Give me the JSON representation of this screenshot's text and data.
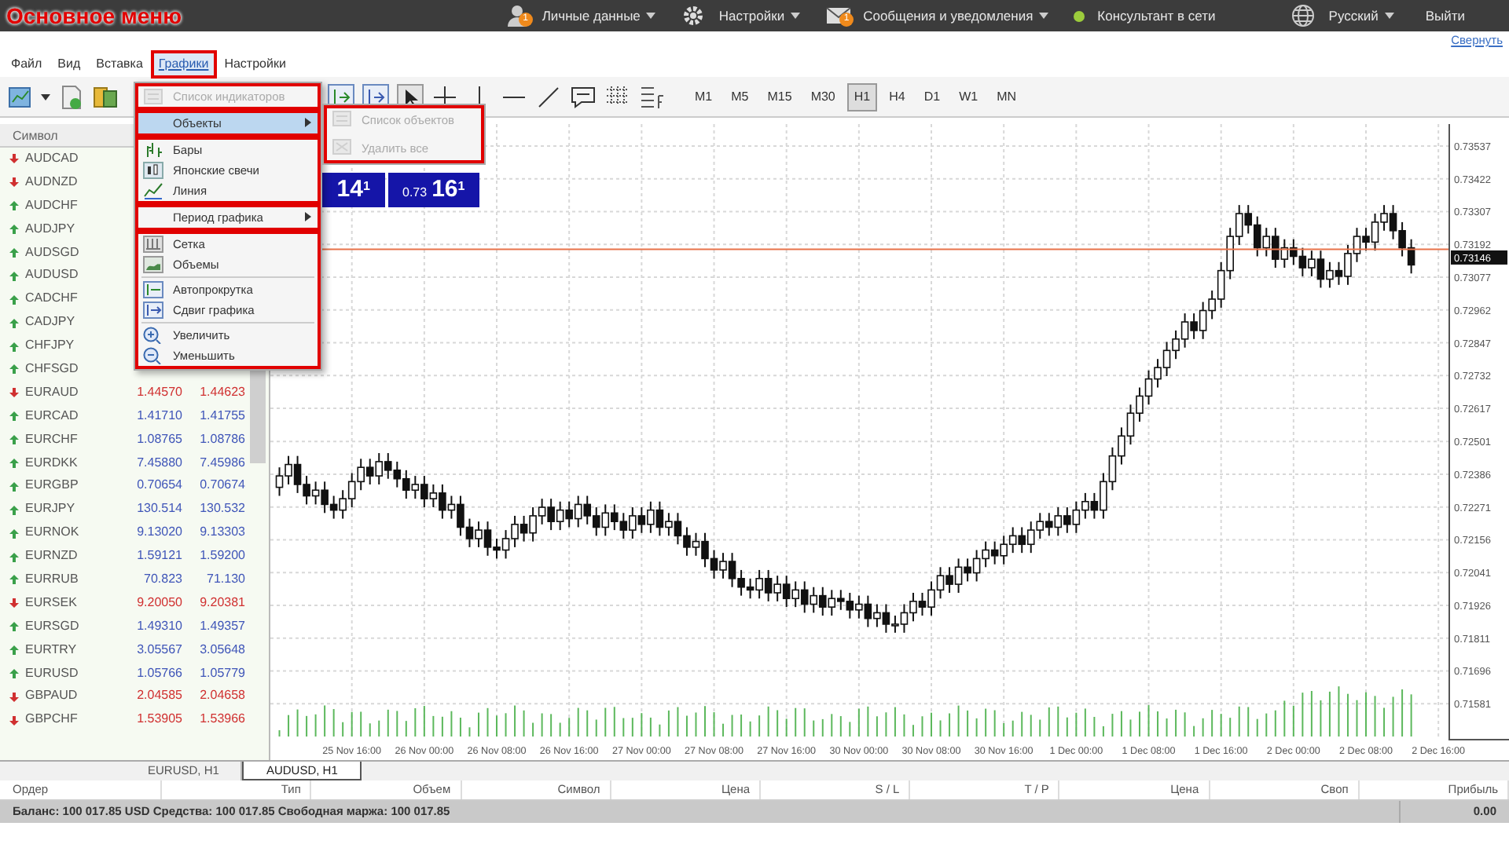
{
  "annotation": {
    "title": "Основное меню"
  },
  "top_bar": {
    "items": [
      {
        "kind": "user",
        "label": "Личные данные",
        "badge": "1",
        "dropdown": true
      },
      {
        "kind": "gear",
        "label": "Настройки",
        "dropdown": true
      },
      {
        "kind": "mail",
        "label": "Сообщения и уведомления",
        "badge": "1",
        "dropdown": true
      },
      {
        "kind": "status",
        "label": "Консультант в сети",
        "color": "#9ccc3c",
        "dropdown": false
      },
      {
        "kind": "globe",
        "label": "Русский",
        "dropdown": true
      },
      {
        "kind": "plain",
        "label": "Выйти",
        "dropdown": false
      }
    ]
  },
  "collapse_link": "Свернуть",
  "menu_bar": [
    {
      "label": "Файл",
      "selected": false
    },
    {
      "label": "Вид",
      "selected": false
    },
    {
      "label": "Вставка",
      "selected": false
    },
    {
      "label": "Графики",
      "selected": true
    },
    {
      "label": "Настройки",
      "selected": false
    }
  ],
  "timeframes": [
    {
      "label": "M1",
      "selected": false
    },
    {
      "label": "M5",
      "selected": false
    },
    {
      "label": "M15",
      "selected": false
    },
    {
      "label": "M30",
      "selected": false
    },
    {
      "label": "H1",
      "selected": true
    },
    {
      "label": "H4",
      "selected": false
    },
    {
      "label": "D1",
      "selected": false
    },
    {
      "label": "W1",
      "selected": false
    },
    {
      "label": "MN",
      "selected": false
    }
  ],
  "watchlist": {
    "columns": [
      "Символ"
    ],
    "rows": [
      {
        "symbol": "AUDCAD",
        "up": false
      },
      {
        "symbol": "AUDNZD",
        "up": false
      },
      {
        "symbol": "AUDCHF",
        "up": true
      },
      {
        "symbol": "AUDJPY",
        "up": true
      },
      {
        "symbol": "AUDSGD",
        "up": true
      },
      {
        "symbol": "AUDUSD",
        "up": true
      },
      {
        "symbol": "CADCHF",
        "up": true
      },
      {
        "symbol": "CADJPY",
        "up": true
      },
      {
        "symbol": "CHFJPY",
        "up": true
      },
      {
        "symbol": "CHFSGD",
        "up": true
      },
      {
        "symbol": "EURAUD",
        "up": false,
        "bid": "1.44570",
        "ask": "1.44623"
      },
      {
        "symbol": "EURCAD",
        "up": true,
        "bid": "1.41710",
        "ask": "1.41755"
      },
      {
        "symbol": "EURCHF",
        "up": true,
        "bid": "1.08765",
        "ask": "1.08786"
      },
      {
        "symbol": "EURDKK",
        "up": true,
        "bid": "7.45880",
        "ask": "7.45986"
      },
      {
        "symbol": "EURGBP",
        "up": true,
        "bid": "0.70654",
        "ask": "0.70674"
      },
      {
        "symbol": "EURJPY",
        "up": true,
        "bid": "130.514",
        "ask": "130.532"
      },
      {
        "symbol": "EURNOK",
        "up": true,
        "bid": "9.13020",
        "ask": "9.13303"
      },
      {
        "symbol": "EURNZD",
        "up": true,
        "bid": "1.59121",
        "ask": "1.59200"
      },
      {
        "symbol": "EURRUB",
        "up": true,
        "bid": "70.823",
        "ask": "71.130"
      },
      {
        "symbol": "EURSEK",
        "up": false,
        "bid": "9.20050",
        "ask": "9.20381"
      },
      {
        "symbol": "EURSGD",
        "up": true,
        "bid": "1.49310",
        "ask": "1.49357"
      },
      {
        "symbol": "EURTRY",
        "up": true,
        "bid": "3.05567",
        "ask": "3.05648"
      },
      {
        "symbol": "EURUSD",
        "up": true,
        "bid": "1.05766",
        "ask": "1.05779"
      },
      {
        "symbol": "GBPAUD",
        "up": false,
        "bid": "2.04585",
        "ask": "2.04658"
      },
      {
        "symbol": "GBPCHF",
        "up": false,
        "bid": "1.53905",
        "ask": "1.53966"
      }
    ]
  },
  "chart_menu": {
    "groups": [
      [
        {
          "kind": "command",
          "label": "Список индикаторов",
          "disabled": true
        }
      ],
      [
        {
          "kind": "submenu",
          "label": "Объекты",
          "disabled": false,
          "selected": true
        }
      ],
      [
        {
          "kind": "command",
          "label": "Бары",
          "disabled": false
        },
        {
          "kind": "command",
          "label": "Японские свечи",
          "disabled": false
        },
        {
          "kind": "command",
          "label": "Линия",
          "disabled": false
        }
      ],
      [
        {
          "kind": "submenu",
          "label": "Период графика",
          "disabled": false,
          "selected": false
        }
      ],
      [
        {
          "kind": "command",
          "label": "Сетка",
          "disabled": false
        },
        {
          "kind": "command",
          "label": "Объемы",
          "disabled": false
        },
        {
          "kind": "separator"
        },
        {
          "kind": "command",
          "label": "Автопрокрутка",
          "disabled": false
        },
        {
          "kind": "command",
          "label": "Сдвиг графика",
          "disabled": false
        },
        {
          "kind": "separator"
        },
        {
          "kind": "command",
          "label": "Увеличить",
          "disabled": false
        },
        {
          "kind": "command",
          "label": "Уменьшить",
          "disabled": false
        }
      ]
    ],
    "submenu": [
      {
        "label": "Список объектов",
        "disabled": true
      },
      {
        "label": "Удалить все",
        "disabled": true
      }
    ]
  },
  "one_click": {
    "sell": "14$^{1}$",
    "buy_prefix": "0.73",
    "buy": "16$^{1}$"
  },
  "chart": {
    "current_price": "0.73146",
    "chart_data": {
      "type": "candlestick",
      "categories": [
        null,
        null,
        null,
        null,
        null,
        null,
        null,
        null,
        "25 Nov 16:00",
        null,
        null,
        null,
        null,
        null,
        null,
        null,
        "26 Nov 00:00",
        null,
        null,
        null,
        null,
        null,
        null,
        null,
        "26 Nov 08:00",
        null,
        null,
        null,
        null,
        null,
        null,
        null,
        "26 Nov 16:00",
        null,
        null,
        null,
        null,
        null,
        null,
        null,
        "27 Nov 00:00",
        null,
        null,
        null,
        null,
        null,
        null,
        null,
        "27 Nov 08:00",
        null,
        null,
        null,
        null,
        null,
        null,
        null,
        "27 Nov 16:00",
        null,
        null,
        null,
        null,
        null,
        null,
        null,
        "30 Nov 00:00",
        null,
        null,
        null,
        null,
        null,
        null,
        null,
        "30 Nov 08:00",
        null,
        null,
        null,
        null,
        null,
        null,
        null,
        "30 Nov 16:00",
        null,
        null,
        null,
        null,
        null,
        null,
        null,
        "1 Dec 00:00",
        null,
        null,
        null,
        null,
        null,
        null,
        null,
        "1 Dec 08:00",
        null,
        null,
        null,
        null,
        null,
        null,
        null,
        "1 Dec 16:00",
        null,
        null,
        null,
        null,
        null,
        null,
        null,
        "2 Dec 00:00",
        null,
        null,
        null,
        null,
        null,
        null,
        null,
        "2 Dec 08:00",
        null,
        null,
        null,
        null,
        null,
        null,
        null,
        "2 Dec 16:00"
      ],
      "ohlc": [
        [
          0.7234,
          0.7241,
          0.7231,
          0.7238
        ],
        [
          0.7238,
          0.7245,
          0.7235,
          0.7242
        ],
        [
          0.7242,
          0.7245,
          0.7232,
          0.7235
        ],
        [
          0.7235,
          0.7238,
          0.7228,
          0.7231
        ],
        [
          0.7231,
          0.7236,
          0.7228,
          0.7233
        ],
        [
          0.7233,
          0.7236,
          0.7225,
          0.7228
        ],
        [
          0.7228,
          0.7231,
          0.7223,
          0.7226
        ],
        [
          0.7226,
          0.7233,
          0.7223,
          0.723
        ],
        [
          0.723,
          0.7239,
          0.7227,
          0.7236
        ],
        [
          0.7236,
          0.7244,
          0.7233,
          0.7241
        ],
        [
          0.7241,
          0.7244,
          0.7235,
          0.7238
        ],
        [
          0.7238,
          0.7246,
          0.7235,
          0.7243
        ],
        [
          0.7243,
          0.7246,
          0.7237,
          0.724
        ],
        [
          0.724,
          0.7243,
          0.7234,
          0.7237
        ],
        [
          0.7237,
          0.724,
          0.723,
          0.7233
        ],
        [
          0.7233,
          0.7238,
          0.723,
          0.7235
        ],
        [
          0.7235,
          0.7238,
          0.7227,
          0.723
        ],
        [
          0.723,
          0.7235,
          0.7227,
          0.7232
        ],
        [
          0.7232,
          0.7235,
          0.7223,
          0.7226
        ],
        [
          0.7226,
          0.7231,
          0.7223,
          0.7228
        ],
        [
          0.7228,
          0.7231,
          0.7217,
          0.722
        ],
        [
          0.722,
          0.7223,
          0.7213,
          0.7216
        ],
        [
          0.7216,
          0.7222,
          0.7213,
          0.7219
        ],
        [
          0.7219,
          0.7222,
          0.721,
          0.7213
        ],
        [
          0.7213,
          0.7216,
          0.7209,
          0.7212
        ],
        [
          0.7212,
          0.7219,
          0.7209,
          0.7216
        ],
        [
          0.7216,
          0.7224,
          0.7213,
          0.7221
        ],
        [
          0.7221,
          0.7224,
          0.7215,
          0.7218
        ],
        [
          0.7218,
          0.7227,
          0.7215,
          0.7224
        ],
        [
          0.7224,
          0.723,
          0.7221,
          0.7227
        ],
        [
          0.7227,
          0.723,
          0.7219,
          0.7222
        ],
        [
          0.7222,
          0.7229,
          0.7219,
          0.7226
        ],
        [
          0.7226,
          0.7229,
          0.722,
          0.7223
        ],
        [
          0.7223,
          0.7231,
          0.722,
          0.7228
        ],
        [
          0.7228,
          0.7231,
          0.7221,
          0.7224
        ],
        [
          0.7224,
          0.7227,
          0.7217,
          0.722
        ],
        [
          0.722,
          0.7228,
          0.7217,
          0.7225
        ],
        [
          0.7225,
          0.7228,
          0.7219,
          0.7222
        ],
        [
          0.7222,
          0.7225,
          0.7216,
          0.7219
        ],
        [
          0.7219,
          0.7227,
          0.7216,
          0.7224
        ],
        [
          0.7224,
          0.7227,
          0.7218,
          0.7221
        ],
        [
          0.7221,
          0.7229,
          0.7218,
          0.7226
        ],
        [
          0.7226,
          0.7229,
          0.7217,
          0.722
        ],
        [
          0.722,
          0.7225,
          0.7217,
          0.7222
        ],
        [
          0.7222,
          0.7225,
          0.7214,
          0.7217
        ],
        [
          0.7217,
          0.722,
          0.721,
          0.7213
        ],
        [
          0.7213,
          0.7218,
          0.721,
          0.7215
        ],
        [
          0.7215,
          0.7218,
          0.7206,
          0.7209
        ],
        [
          0.7209,
          0.7212,
          0.7202,
          0.7205
        ],
        [
          0.7205,
          0.7211,
          0.7202,
          0.7208
        ],
        [
          0.7208,
          0.7211,
          0.7199,
          0.7202
        ],
        [
          0.7202,
          0.7205,
          0.7196,
          0.7199
        ],
        [
          0.7199,
          0.7202,
          0.7195,
          0.7198
        ],
        [
          0.7198,
          0.7205,
          0.7195,
          0.7202
        ],
        [
          0.7202,
          0.7205,
          0.7194,
          0.7197
        ],
        [
          0.7197,
          0.7203,
          0.7194,
          0.72
        ],
        [
          0.72,
          0.7203,
          0.7192,
          0.7195
        ],
        [
          0.7195,
          0.7201,
          0.7192,
          0.7198
        ],
        [
          0.7198,
          0.7201,
          0.719,
          0.7193
        ],
        [
          0.7193,
          0.7199,
          0.719,
          0.7196
        ],
        [
          0.7196,
          0.7199,
          0.7189,
          0.7192
        ],
        [
          0.7192,
          0.7198,
          0.7189,
          0.7195
        ],
        [
          0.7195,
          0.7198,
          0.7191,
          0.7194
        ],
        [
          0.7194,
          0.7197,
          0.7188,
          0.7191
        ],
        [
          0.7191,
          0.7196,
          0.7188,
          0.7193
        ],
        [
          0.7193,
          0.7196,
          0.7185,
          0.7188
        ],
        [
          0.7188,
          0.7193,
          0.7185,
          0.719
        ],
        [
          0.719,
          0.7193,
          0.7183,
          0.7186
        ],
        [
          0.7186,
          0.7189,
          0.7183,
          0.7186
        ],
        [
          0.7186,
          0.7193,
          0.7183,
          0.719
        ],
        [
          0.719,
          0.7197,
          0.7187,
          0.7194
        ],
        [
          0.7194,
          0.7197,
          0.7189,
          0.7192
        ],
        [
          0.7192,
          0.7201,
          0.7189,
          0.7198
        ],
        [
          0.7198,
          0.7206,
          0.7195,
          0.7203
        ],
        [
          0.7203,
          0.7206,
          0.7197,
          0.72
        ],
        [
          0.72,
          0.7209,
          0.7197,
          0.7206
        ],
        [
          0.7206,
          0.7209,
          0.7201,
          0.7204
        ],
        [
          0.7204,
          0.7212,
          0.7201,
          0.7209
        ],
        [
          0.7209,
          0.7215,
          0.7206,
          0.7212
        ],
        [
          0.7212,
          0.7215,
          0.7207,
          0.721
        ],
        [
          0.721,
          0.7217,
          0.7207,
          0.7214
        ],
        [
          0.7214,
          0.722,
          0.7211,
          0.7217
        ],
        [
          0.7217,
          0.722,
          0.7211,
          0.7214
        ],
        [
          0.7214,
          0.7222,
          0.7211,
          0.7219
        ],
        [
          0.7219,
          0.7225,
          0.7216,
          0.7222
        ],
        [
          0.7222,
          0.7225,
          0.7217,
          0.722
        ],
        [
          0.722,
          0.7227,
          0.7217,
          0.7224
        ],
        [
          0.7224,
          0.7227,
          0.7218,
          0.7221
        ],
        [
          0.7221,
          0.7229,
          0.7218,
          0.7226
        ],
        [
          0.7226,
          0.7232,
          0.7223,
          0.7229
        ],
        [
          0.7229,
          0.7232,
          0.7223,
          0.7226
        ],
        [
          0.7226,
          0.7239,
          0.7223,
          0.7236
        ],
        [
          0.7236,
          0.7248,
          0.7233,
          0.7245
        ],
        [
          0.7245,
          0.7255,
          0.7242,
          0.7252
        ],
        [
          0.7252,
          0.7263,
          0.7249,
          0.726
        ],
        [
          0.726,
          0.7269,
          0.7257,
          0.7266
        ],
        [
          0.7266,
          0.7275,
          0.7263,
          0.7272
        ],
        [
          0.7272,
          0.7279,
          0.7269,
          0.7276
        ],
        [
          0.7276,
          0.7285,
          0.7273,
          0.7282
        ],
        [
          0.7282,
          0.7289,
          0.7279,
          0.7286
        ],
        [
          0.7286,
          0.7295,
          0.7283,
          0.7292
        ],
        [
          0.7292,
          0.7295,
          0.7286,
          0.7289
        ],
        [
          0.7289,
          0.7299,
          0.7286,
          0.7296
        ],
        [
          0.7296,
          0.7303,
          0.7293,
          0.73
        ],
        [
          0.73,
          0.7313,
          0.7297,
          0.731
        ],
        [
          0.731,
          0.7325,
          0.7307,
          0.7322
        ],
        [
          0.7322,
          0.7333,
          0.7319,
          0.733
        ],
        [
          0.733,
          0.7333,
          0.7323,
          0.7326
        ],
        [
          0.7326,
          0.7329,
          0.7315,
          0.7318
        ],
        [
          0.7318,
          0.7325,
          0.7315,
          0.7322
        ],
        [
          0.7322,
          0.7325,
          0.7311,
          0.7314
        ],
        [
          0.7314,
          0.7321,
          0.7311,
          0.7318
        ],
        [
          0.7318,
          0.7321,
          0.7312,
          0.7315
        ],
        [
          0.7315,
          0.7318,
          0.7308,
          0.7311
        ],
        [
          0.7311,
          0.7317,
          0.7308,
          0.7314
        ],
        [
          0.7314,
          0.7317,
          0.7304,
          0.7307
        ],
        [
          0.7307,
          0.7313,
          0.7304,
          0.731
        ],
        [
          0.731,
          0.7313,
          0.7305,
          0.7308
        ],
        [
          0.7308,
          0.7319,
          0.7305,
          0.7316
        ],
        [
          0.7316,
          0.7325,
          0.7313,
          0.7322
        ],
        [
          0.7322,
          0.7325,
          0.7317,
          0.732
        ],
        [
          0.732,
          0.733,
          0.7317,
          0.7327
        ],
        [
          0.7327,
          0.7333,
          0.7324,
          0.733
        ],
        [
          0.733,
          0.7333,
          0.7321,
          0.7324
        ],
        [
          0.7324,
          0.7327,
          0.7315,
          0.7318
        ],
        [
          0.7318,
          0.7321,
          0.7309,
          0.7312
        ],
        null,
        null,
        null
      ],
      "ylim": [
        0.71455,
        0.73614
      ],
      "grid": true,
      "ref_lines": [
        {
          "axis": "y",
          "value": 0.73175,
          "color": "#e8734a"
        }
      ],
      "yticks": [
        {
          "value": 0.73537,
          "label": "0.73537"
        },
        {
          "value": 0.73422,
          "label": "0.73422"
        },
        {
          "value": 0.73307,
          "label": "0.73307"
        },
        {
          "value": 0.73192,
          "label": "0.73192"
        },
        {
          "value": 0.73077,
          "label": "0.73077"
        },
        {
          "value": 0.72962,
          "label": "0.72962"
        },
        {
          "value": 0.72847,
          "label": "0.72847"
        },
        {
          "value": 0.72732,
          "label": "0.72732"
        },
        {
          "value": 0.72617,
          "label": "0.72617"
        },
        {
          "value": 0.72501,
          "label": "0.72501"
        },
        {
          "value": 0.72386,
          "label": "0.72386"
        },
        {
          "value": 0.72271,
          "label": "0.72271"
        },
        {
          "value": 0.72156,
          "label": "0.72156"
        },
        {
          "value": 0.72041,
          "label": "0.72041"
        },
        {
          "value": 0.71926,
          "label": "0.71926"
        },
        {
          "value": 0.71811,
          "label": "0.71811"
        },
        {
          "value": 0.71696,
          "label": "0.71696"
        },
        {
          "value": 0.71581,
          "label": "0.71581"
        }
      ]
    }
  },
  "chart_tabs": [
    {
      "label": "EURUSD, H1",
      "selected": false
    },
    {
      "label": "AUDUSD, H1",
      "selected": true
    }
  ],
  "trade_table": {
    "columns": [
      "Ордер",
      "Тип",
      "Объем",
      "Символ",
      "Цена",
      "S / L",
      "T / P",
      "Цена",
      "Своп",
      "Прибыль"
    ],
    "summary": "Баланс: 100 017.85 USD  Средства: 100 017.85  Свободная маржа: 100 017.85",
    "profit": "0.00"
  }
}
